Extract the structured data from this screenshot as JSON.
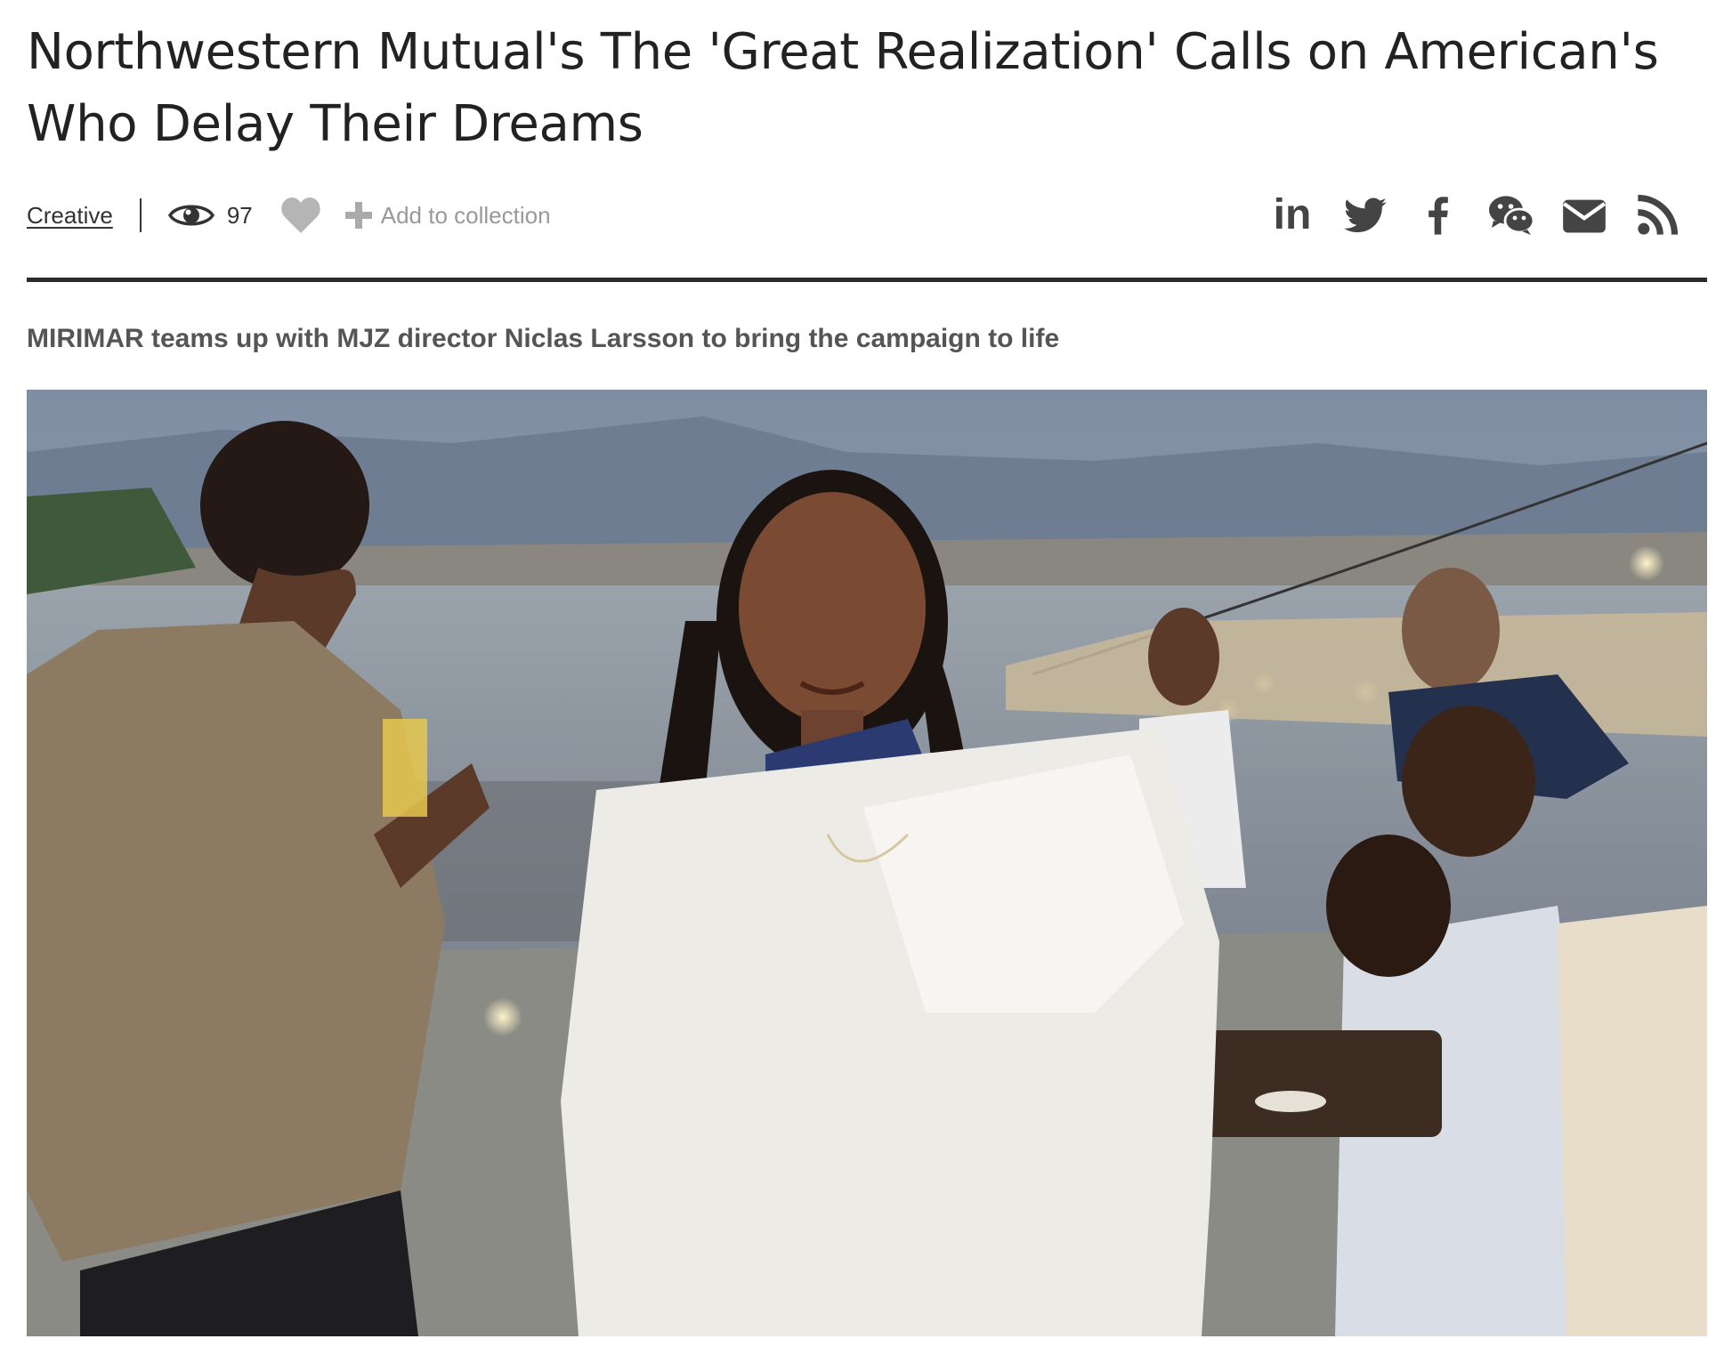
{
  "article": {
    "title": "Northwestern Mutual's The 'Great Realization' Calls on American's Who Delay Their Dreams",
    "subtitle": "MIRIMAR teams up with MJZ director Niclas Larsson to bring the campaign to life"
  },
  "meta": {
    "category": "Creative",
    "views": "97",
    "add_to_collection": "Add to collection",
    "icons": [
      "eye-icon",
      "heart-icon",
      "plus-icon"
    ]
  },
  "share": {
    "linkedin_label": "in",
    "icons": [
      "linkedin-icon",
      "twitter-icon",
      "facebook-icon",
      "wechat-icon",
      "email-icon",
      "rss-icon"
    ]
  },
  "colors": {
    "text": "#222222",
    "meta_text": "#333333",
    "muted": "#999999",
    "subtitle": "#555555",
    "rule": "#2b2b2b",
    "share_icons": "#444444"
  }
}
